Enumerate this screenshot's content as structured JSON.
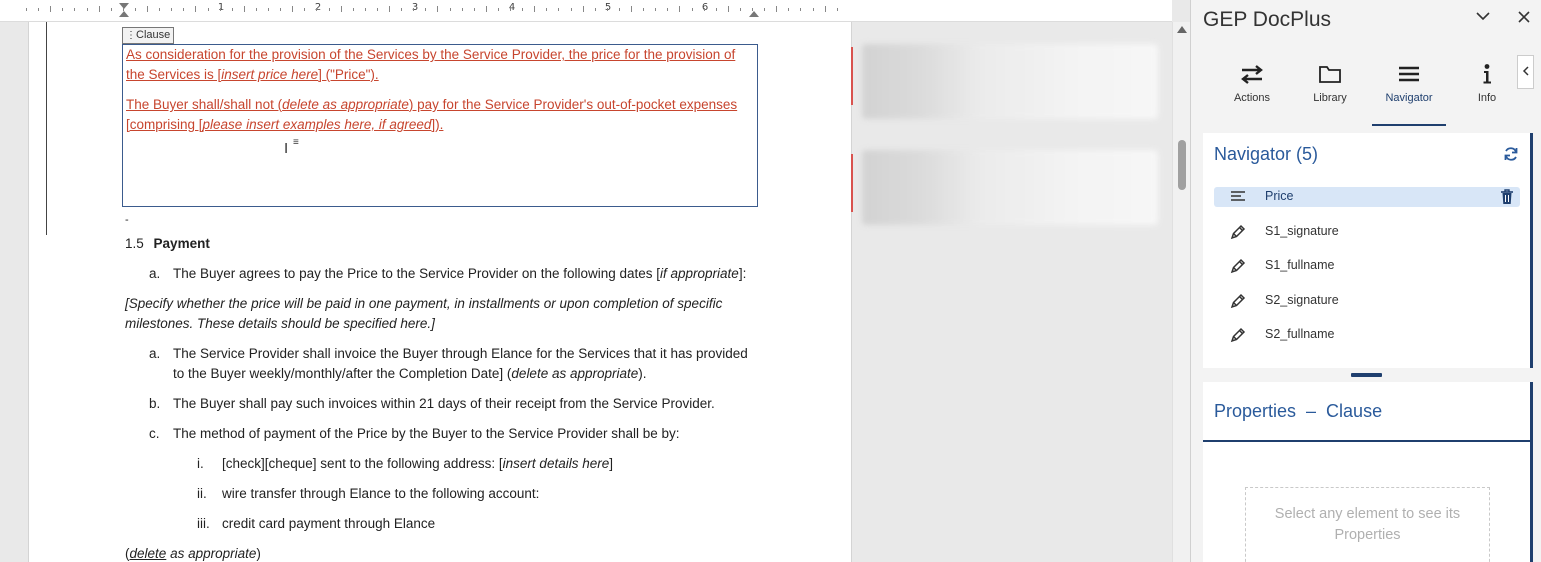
{
  "ruler": {
    "numbers": [
      "1",
      "2",
      "3",
      "4",
      "5",
      "6"
    ]
  },
  "document": {
    "clause_tag": "Clause",
    "clause_para1": "As consideration for the provision of the Services by the Service Provider, the price for the provision of the Services is [insert price here] (\"Price\").",
    "clause_para2": "The Buyer shall/shall not (delete as appropriate) pay for the Service Provider's out-of-pocket expenses [comprising [please insert examples here, if agreed]).",
    "dash": "-",
    "section_number": "1.5",
    "section_title": "Payment",
    "item_a1_marker": "a.",
    "item_a1_text": "The Buyer agrees to pay the Price to the Service Provider on the following dates [if appropriate]:",
    "note_line1": "[Specify whether the price will be paid in one payment, in installments or upon completion of specific",
    "note_line2": "milestones. These details should be specified here.]",
    "item_a2_marker": "a.",
    "item_a2_line1": "The Service Provider shall invoice the Buyer through Elance for the Services that it has provided",
    "item_a2_line2": "to the Buyer weekly/monthly/after the Completion Date] (delete as appropriate).",
    "item_b_marker": "b.",
    "item_b_text": "The Buyer shall pay such invoices within 21 days of their receipt from the Service Provider.",
    "item_c_marker": "c.",
    "item_c_text": "The method of payment of the Price by the Buyer to the Service Provider shall be by:",
    "sub_i_marker": "i.",
    "sub_i_text": "[check][cheque] sent to the following address: [insert details here]",
    "sub_ii_marker": "ii.",
    "sub_ii_text": "wire transfer through Elance to the following account:",
    "sub_iii_marker": "iii.",
    "sub_iii_text": "credit card payment through Elance",
    "footer_text": "(delete as appropriate)"
  },
  "panel": {
    "title": "GEP DocPlus",
    "tabs": [
      {
        "label": "Actions",
        "icon": "arrows-exchange-icon"
      },
      {
        "label": "Library",
        "icon": "folder-icon"
      },
      {
        "label": "Navigator",
        "icon": "hamburger-menu-icon",
        "active": true
      },
      {
        "label": "Info",
        "icon": "info-icon"
      }
    ],
    "navigator": {
      "heading": "Navigator (5)",
      "items": [
        {
          "label": "Price",
          "icon": "text-lines-icon",
          "selected": true
        },
        {
          "label": "S1_signature",
          "icon": "pen-icon"
        },
        {
          "label": "S1_fullname",
          "icon": "pen-icon"
        },
        {
          "label": "S2_signature",
          "icon": "pen-icon"
        },
        {
          "label": "S2_fullname",
          "icon": "pen-icon"
        }
      ]
    },
    "properties": {
      "heading": "Properties  –  Clause",
      "empty_message": "Select any element to see its Properties"
    }
  },
  "colors": {
    "accent": "#1f3f6e",
    "heading_blue": "#2a5a9b",
    "tracked_change": "#c7452e",
    "selected_row": "#d8e6f7"
  }
}
